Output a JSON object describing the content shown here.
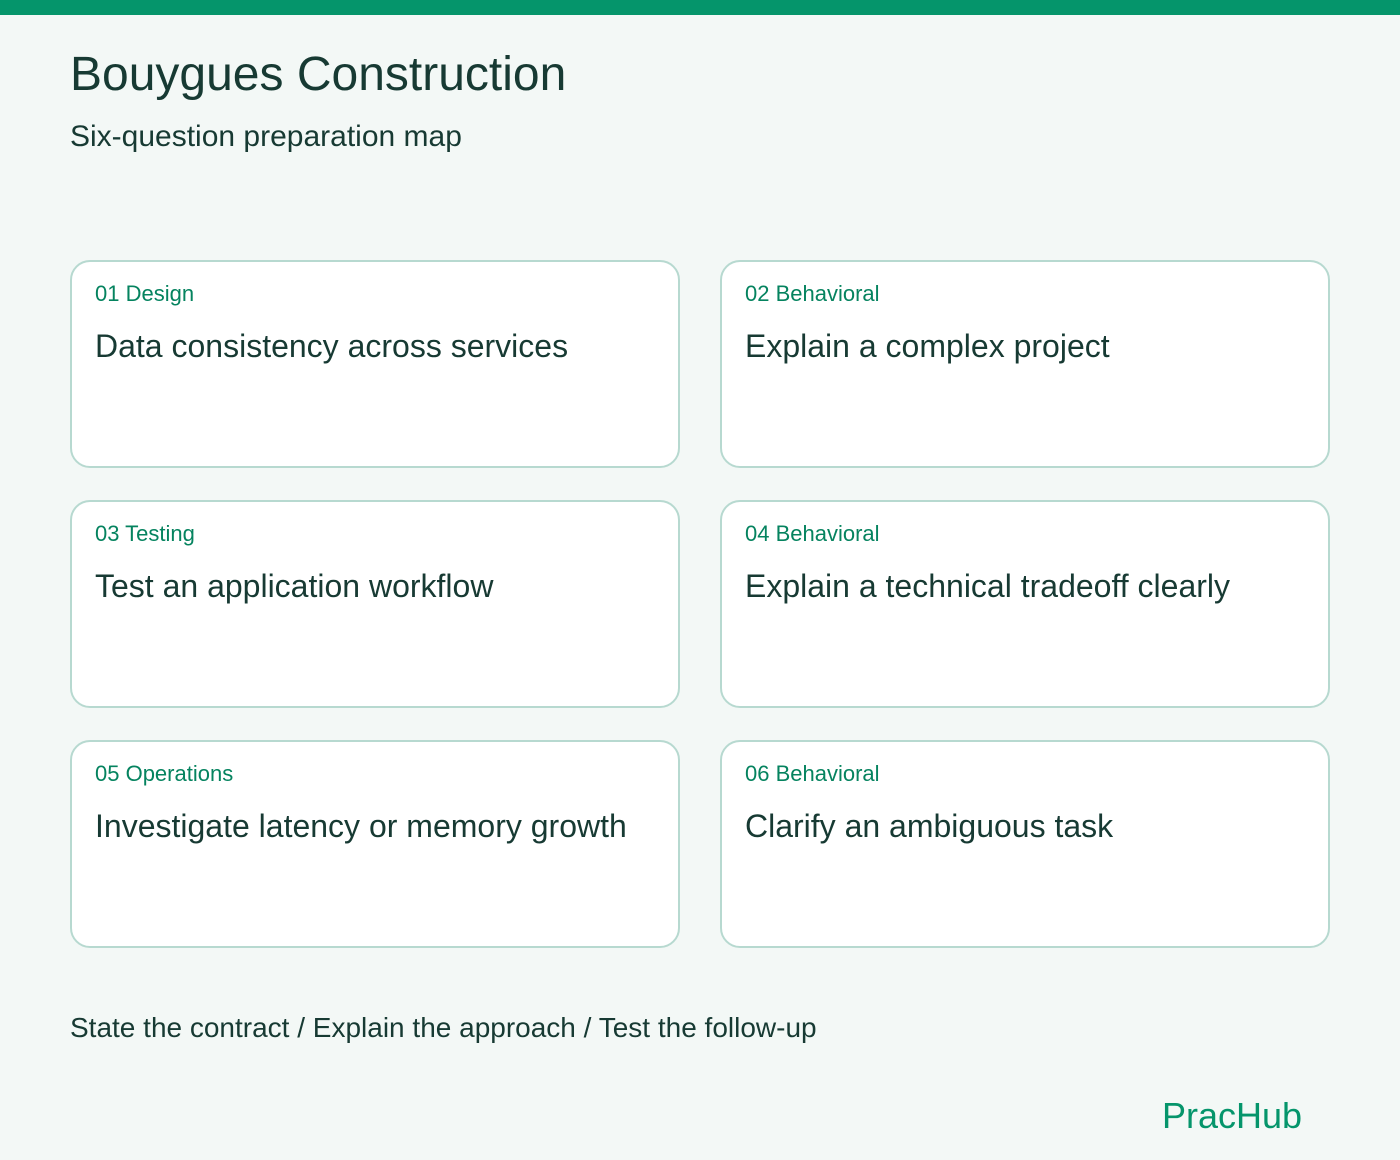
{
  "header": {
    "title": "Bouygues Construction",
    "subtitle": "Six-question preparation map"
  },
  "cards": [
    {
      "tag": "01 Design",
      "title": "Data consistency across services"
    },
    {
      "tag": "02 Behavioral",
      "title": "Explain a complex project"
    },
    {
      "tag": "03 Testing",
      "title": "Test an application workflow"
    },
    {
      "tag": "04 Behavioral",
      "title": "Explain a technical tradeoff clearly"
    },
    {
      "tag": "05 Operations",
      "title": "Investigate latency or memory growth"
    },
    {
      "tag": "06 Behavioral",
      "title": "Clarify an ambiguous task"
    }
  ],
  "footer": {
    "steps": "State the contract / Explain the approach / Test the follow-up",
    "brand": "PracHub"
  },
  "colors": {
    "accent": "#05956b",
    "background": "#f3f8f6",
    "card_border": "#b7d9d0",
    "text": "#173a33"
  }
}
